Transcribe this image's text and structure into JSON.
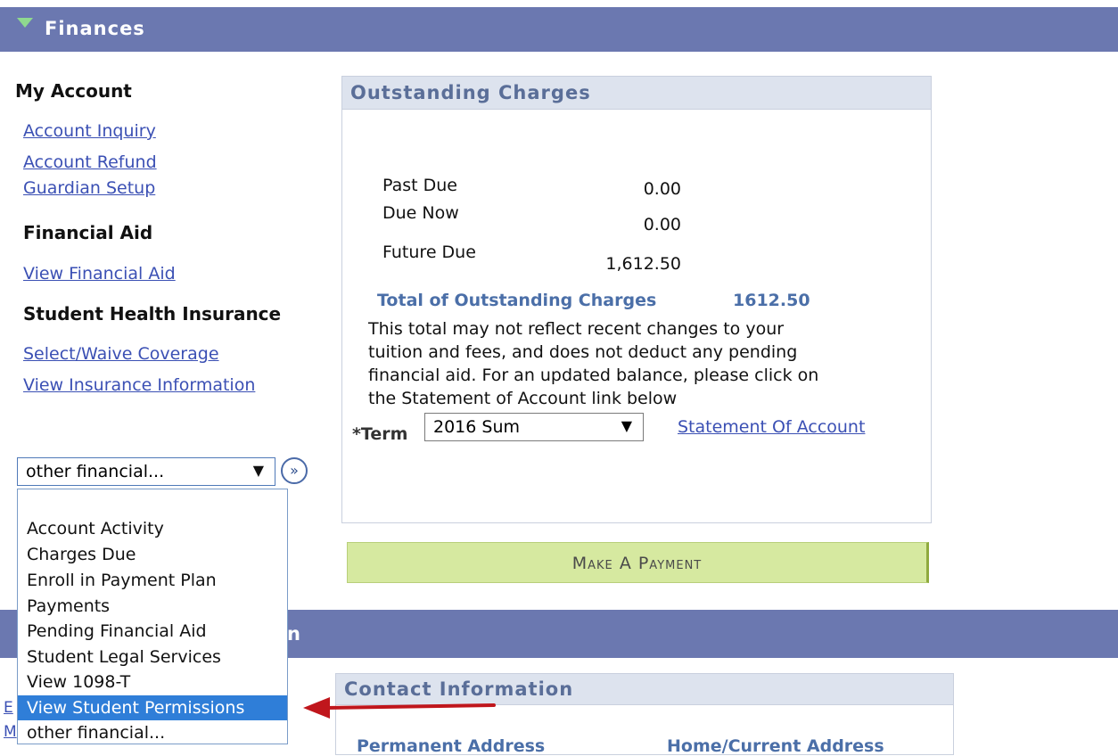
{
  "finances": {
    "title": "Finances",
    "my_account": {
      "heading": "My Account",
      "links": [
        "Account Inquiry",
        "Account Refund",
        "Guardian Setup"
      ]
    },
    "financial_aid": {
      "heading": "Financial Aid",
      "links": [
        "View Financial Aid"
      ]
    },
    "health_insurance": {
      "heading": "Student Health Insurance",
      "links": [
        "Select/Waive Coverage",
        "View Insurance Information"
      ]
    },
    "other_select": {
      "value": "other financial...",
      "arrow": "▼",
      "go_label": "»",
      "options": [
        "Account Activity",
        "Charges Due",
        "Enroll in Payment Plan",
        "Payments",
        "Pending Financial Aid",
        "Student Legal Services",
        "View 1098-T",
        "View Student Permissions",
        "other financial..."
      ],
      "highlighted_option": "View Student Permissions"
    },
    "outstanding": {
      "title": "Outstanding Charges",
      "past_due_label": "Past Due",
      "past_due_value": "0.00",
      "due_now_label": "Due Now",
      "due_now_value": "0.00",
      "future_due_label": "Future Due",
      "future_due_value": "1,612.50",
      "total_label": "Total of Outstanding Charges",
      "total_value": "1612.50",
      "note_lines": [
        "This total may not reflect recent changes to your",
        "tuition and fees, and does not deduct any pending",
        "financial aid. For an updated balance, please click on",
        "the Statement of Account link below"
      ],
      "term_label": "*Term",
      "term_value": "2016 Sum",
      "term_arrow": "▼",
      "statement_link": "Statement Of Account"
    },
    "pay_button": "Make A Payment"
  },
  "personal": {
    "title_fragment": "n",
    "contact_title": "Contact Information",
    "left_fragments": [
      "E",
      "M"
    ],
    "contact_subheads": [
      "Permanent Address",
      "Home/Current Address"
    ]
  },
  "colors": {
    "section_bar": "#6b78b0",
    "link": "#3b50b4",
    "panel_header": "#dde3ee",
    "pay_button": "#d6e9a0",
    "highlight": "#2f7ed8",
    "arrow": "#c0161c"
  },
  "icons": {
    "collapse": "triangle-down-icon",
    "go": "double-chevron-right-icon",
    "pointer": "red-arrow-icon"
  }
}
